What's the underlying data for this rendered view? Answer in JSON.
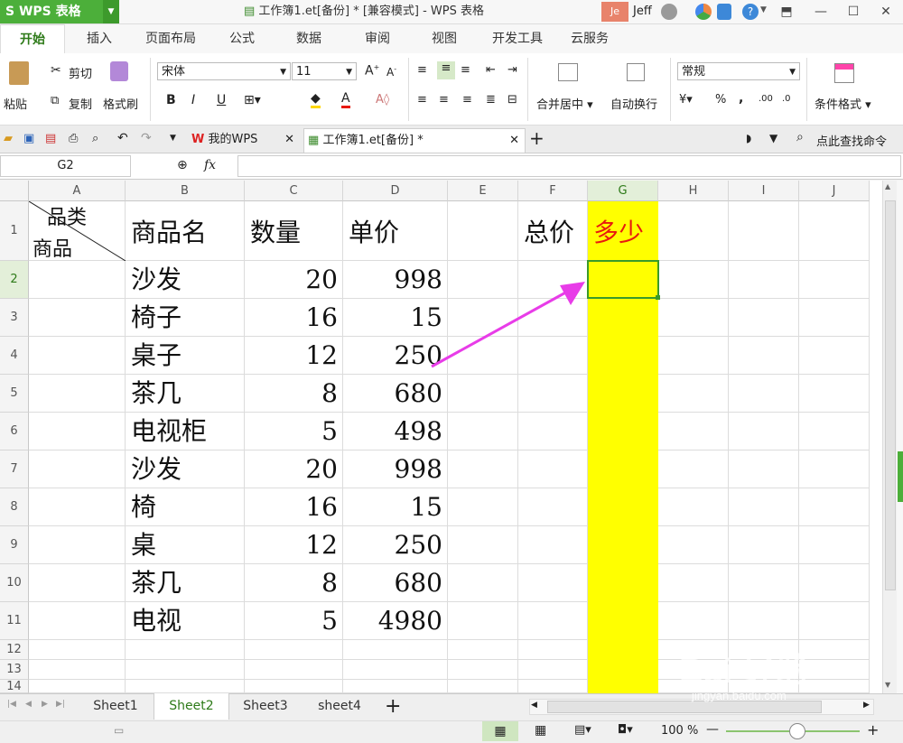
{
  "app": {
    "name": "WPS 表格",
    "logo_letter": "S",
    "window_title": "工作簿1.et[备份] * [兼容模式] - WPS 表格",
    "user_initials": "Je",
    "user_name": "Jeff",
    "accent": "#4caf3a"
  },
  "ribbon_tabs": [
    "开始",
    "插入",
    "页面布局",
    "公式",
    "数据",
    "审阅",
    "视图",
    "开发工具",
    "云服务"
  ],
  "ribbon": {
    "paste": "粘贴",
    "cut": "剪切",
    "copy": "复制",
    "format_painter": "格式刷",
    "font_name": "宋体",
    "font_size": "11",
    "bold": "B",
    "italic": "I",
    "underline": "U",
    "merge_center": "合并居中",
    "auto_wrap": "自动换行",
    "number_format": "常规",
    "percent": "%",
    "comma": ",",
    "conditional_format": "条件格式"
  },
  "doc_tabs": [
    {
      "label": "我的WPS"
    },
    {
      "label": "工作簿1.et[备份] *"
    }
  ],
  "search_command": "点此查找命令",
  "formula_bar": {
    "name_box": "G2",
    "fx": "fx",
    "value": ""
  },
  "columns": [
    "A",
    "B",
    "C",
    "D",
    "E",
    "F",
    "G",
    "H",
    "I",
    "J"
  ],
  "rows": [
    "1",
    "2",
    "3",
    "4",
    "5",
    "6",
    "7",
    "8",
    "9",
    "10",
    "11",
    "12",
    "13",
    "14"
  ],
  "header_row": {
    "a1_top": "品类",
    "a1_bottom": "商品",
    "b1": "商品名",
    "c1": "数量",
    "d1": "单价",
    "f1": "总价",
    "g1": "多少"
  },
  "data_rows": [
    {
      "name": "沙发",
      "qty": "20",
      "price": "998"
    },
    {
      "name": "椅子",
      "qty": "16",
      "price": "15"
    },
    {
      "name": "桌子",
      "qty": "12",
      "price": "250"
    },
    {
      "name": "茶几",
      "qty": "8",
      "price": "680"
    },
    {
      "name": "电视柜",
      "qty": "5",
      "price": "498"
    },
    {
      "name": "沙发",
      "qty": "20",
      "price": "998"
    },
    {
      "name": "椅",
      "qty": "16",
      "price": "15"
    },
    {
      "name": "桌",
      "qty": "12",
      "price": "250"
    },
    {
      "name": "茶几",
      "qty": "8",
      "price": "680"
    },
    {
      "name": "电视",
      "qty": "5",
      "price": "4980"
    }
  ],
  "colors": {
    "highlight_column": "#ffff00",
    "g1_text": "#e8190f",
    "arrow": "#e83ce8",
    "active_border": "#3a9a2a"
  },
  "sheets": [
    "Sheet1",
    "Sheet2",
    "Sheet3",
    "sheet4"
  ],
  "active_sheet": "Sheet2",
  "zoom": "100 %",
  "watermark": {
    "text": "Bai 经验",
    "url": "jingyan.baidu.com"
  }
}
